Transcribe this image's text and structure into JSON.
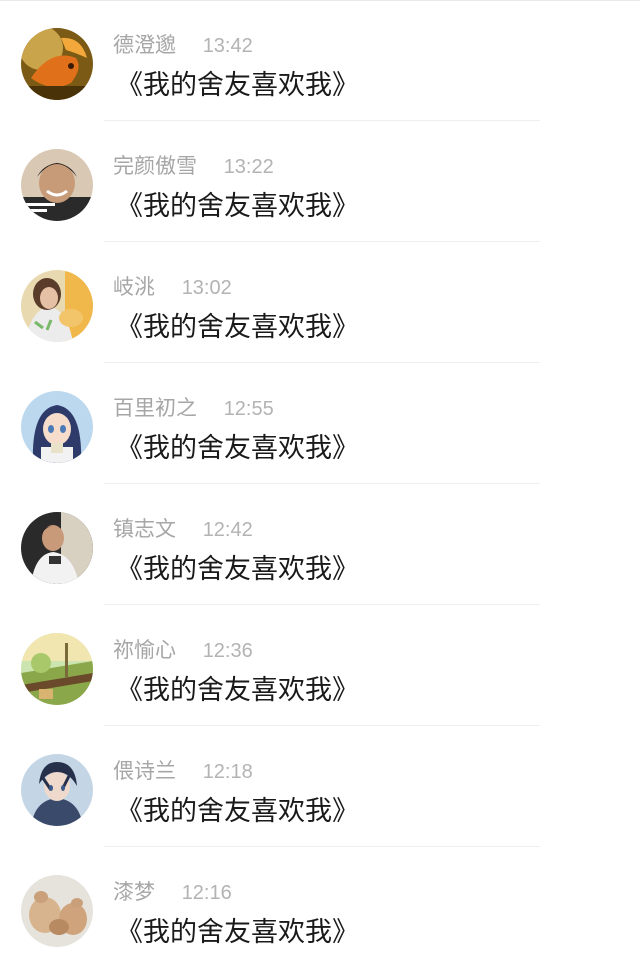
{
  "conversations": [
    {
      "name": "德澄邈",
      "time": "13:42",
      "message": "《我的舍友喜欢我》",
      "avatar": "goldfish-avatar"
    },
    {
      "name": "完颜傲雪",
      "time": "13:22",
      "message": "《我的舍友喜欢我》",
      "avatar": "smiling-boy-avatar"
    },
    {
      "name": "岐洮",
      "time": "13:02",
      "message": "《我的舍友喜欢我》",
      "avatar": "girl-with-cat-avatar"
    },
    {
      "name": "百里初之",
      "time": "12:55",
      "message": "《我的舍友喜欢我》",
      "avatar": "anime-girl-avatar"
    },
    {
      "name": "镇志文",
      "time": "12:42",
      "message": "《我的舍友喜欢我》",
      "avatar": "boy-with-phone-avatar"
    },
    {
      "name": "祢愉心",
      "time": "12:36",
      "message": "《我的舍友喜欢我》",
      "avatar": "countryside-scene-avatar"
    },
    {
      "name": "偎诗兰",
      "time": "12:18",
      "message": "《我的舍友喜欢我》",
      "avatar": "anime-boy-avatar"
    },
    {
      "name": "漆梦",
      "time": "12:16",
      "message": "《我的舍友喜欢我》",
      "avatar": "plush-bear-avatar"
    }
  ]
}
